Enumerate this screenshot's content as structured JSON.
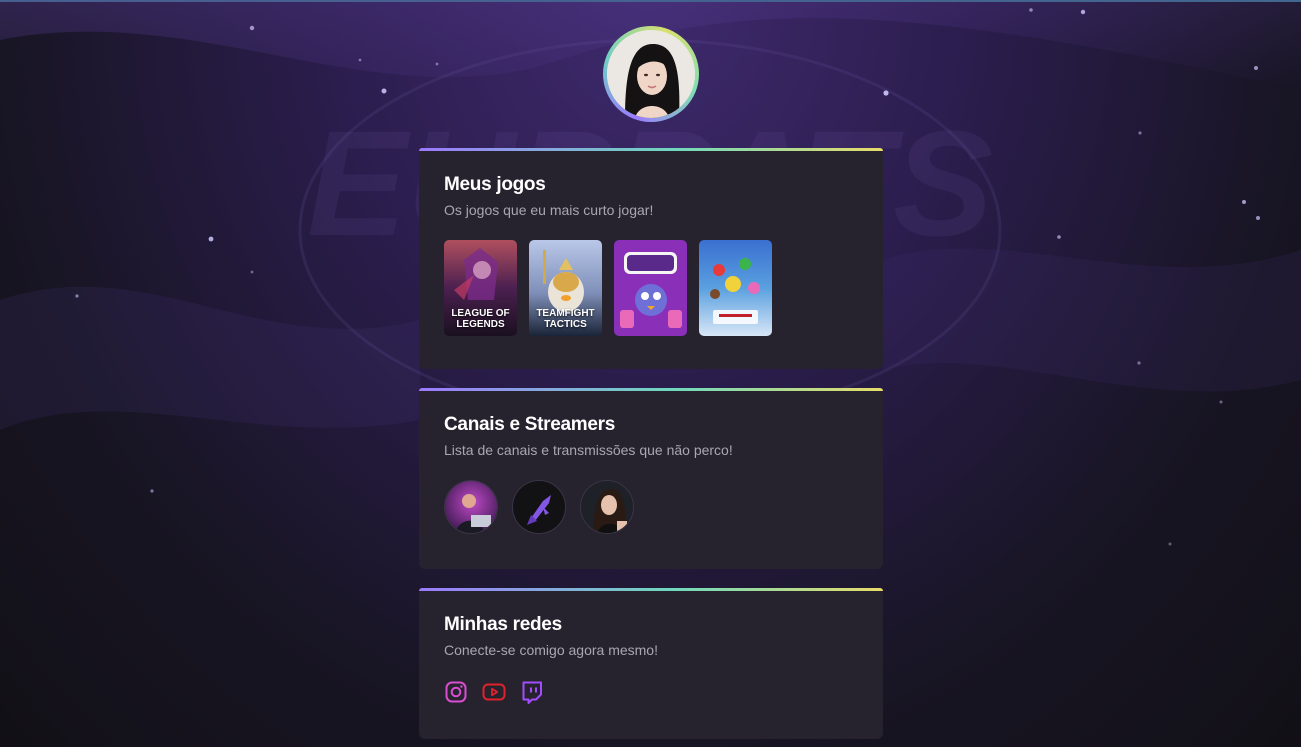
{
  "profile": {
    "avatar_icon": "profile-photo"
  },
  "sections": {
    "games": {
      "title": "Meus jogos",
      "subtitle": "Os jogos que eu mais curto jogar!",
      "items": [
        {
          "label": "LEAGUE OF LEGENDS",
          "color": "#5a2a5e"
        },
        {
          "label": "TEAMFIGHT TACTICS",
          "color": "#6f8fd0"
        },
        {
          "label": "",
          "color": "#8a2fb8"
        },
        {
          "label": "",
          "color": "#4d8ed6"
        }
      ]
    },
    "streamers": {
      "title": "Canais e Streamers",
      "subtitle": "Lista de canais e transmissões que não perco!",
      "items": [
        {
          "icon": "streamer-photo"
        },
        {
          "icon": "rocketseat-logo"
        },
        {
          "icon": "streamer-photo"
        }
      ]
    },
    "socials": {
      "title": "Minhas redes",
      "subtitle": "Conecte-se comigo agora mesmo!",
      "items": [
        {
          "icon": "instagram-icon",
          "color": "#d94ed0"
        },
        {
          "icon": "youtube-icon",
          "color": "#e0222b"
        },
        {
          "icon": "twitch-icon",
          "color": "#a34cff"
        }
      ]
    }
  }
}
